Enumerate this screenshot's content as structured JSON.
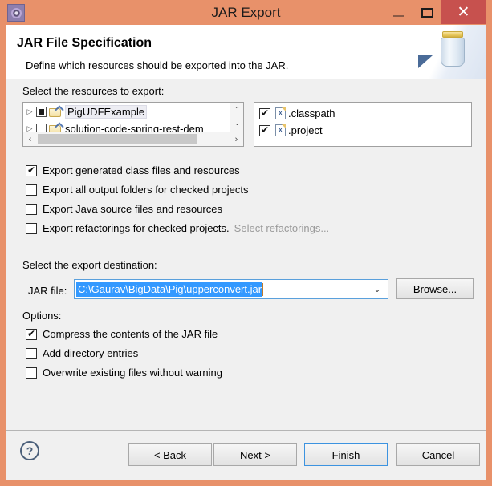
{
  "window": {
    "title": "JAR Export",
    "app_icon": "eclipse-gear-icon",
    "minimize_label": "—",
    "maximize_label": "□",
    "close_label": "✕"
  },
  "header": {
    "title": "JAR File Specification",
    "description": "Define which resources should be exported into the JAR.",
    "banner_icon": "jar-illustration"
  },
  "resources": {
    "section_label": "Select the resources to export:",
    "tree": [
      {
        "label": "PigUDFExample",
        "check_state": "partial",
        "expander": "▷",
        "selected": true
      },
      {
        "label": "solution-code-spring-rest-dem",
        "check_state": "unchecked",
        "expander": "▷",
        "selected": false
      }
    ],
    "files": [
      {
        "label": ".classpath",
        "checked": true,
        "icon": "xml-file-icon"
      },
      {
        "label": ".project",
        "checked": true,
        "icon": "xml-file-icon"
      }
    ],
    "scroll": {
      "up_arrow": "⌃",
      "down_arrow": "⌄",
      "left_arrow": "‹",
      "right_arrow": "›"
    }
  },
  "export_options": [
    {
      "label": "Export generated class files and resources",
      "checked": true
    },
    {
      "label": "Export all output folders for checked projects",
      "checked": false
    },
    {
      "label": "Export Java source files and resources",
      "checked": false
    },
    {
      "label": "Export refactorings for checked projects.",
      "checked": false,
      "link": "Select refactorings..."
    }
  ],
  "destination": {
    "section_label": "Select the export destination:",
    "jar_file_label": "JAR file:",
    "jar_file_value": "C:\\Gaurav\\BigData\\Pig\\upperconvert.jar",
    "dropdown_caret": "⌄",
    "browse_label": "Browse..."
  },
  "options": {
    "section_label": "Options:",
    "items": [
      {
        "label": "Compress the contents of the JAR file",
        "checked": true
      },
      {
        "label": "Add directory entries",
        "checked": false
      },
      {
        "label": "Overwrite existing files without warning",
        "checked": false
      }
    ]
  },
  "footer": {
    "help_label": "?",
    "back_label": "< Back",
    "next_label": "Next >",
    "finish_label": "Finish",
    "cancel_label": "Cancel"
  },
  "colors": {
    "titlebar": "#e8916a",
    "close_button": "#c7514e",
    "selection": "#3399ff",
    "focus_border": "#3c93e0",
    "body": "#f0f0f0"
  }
}
